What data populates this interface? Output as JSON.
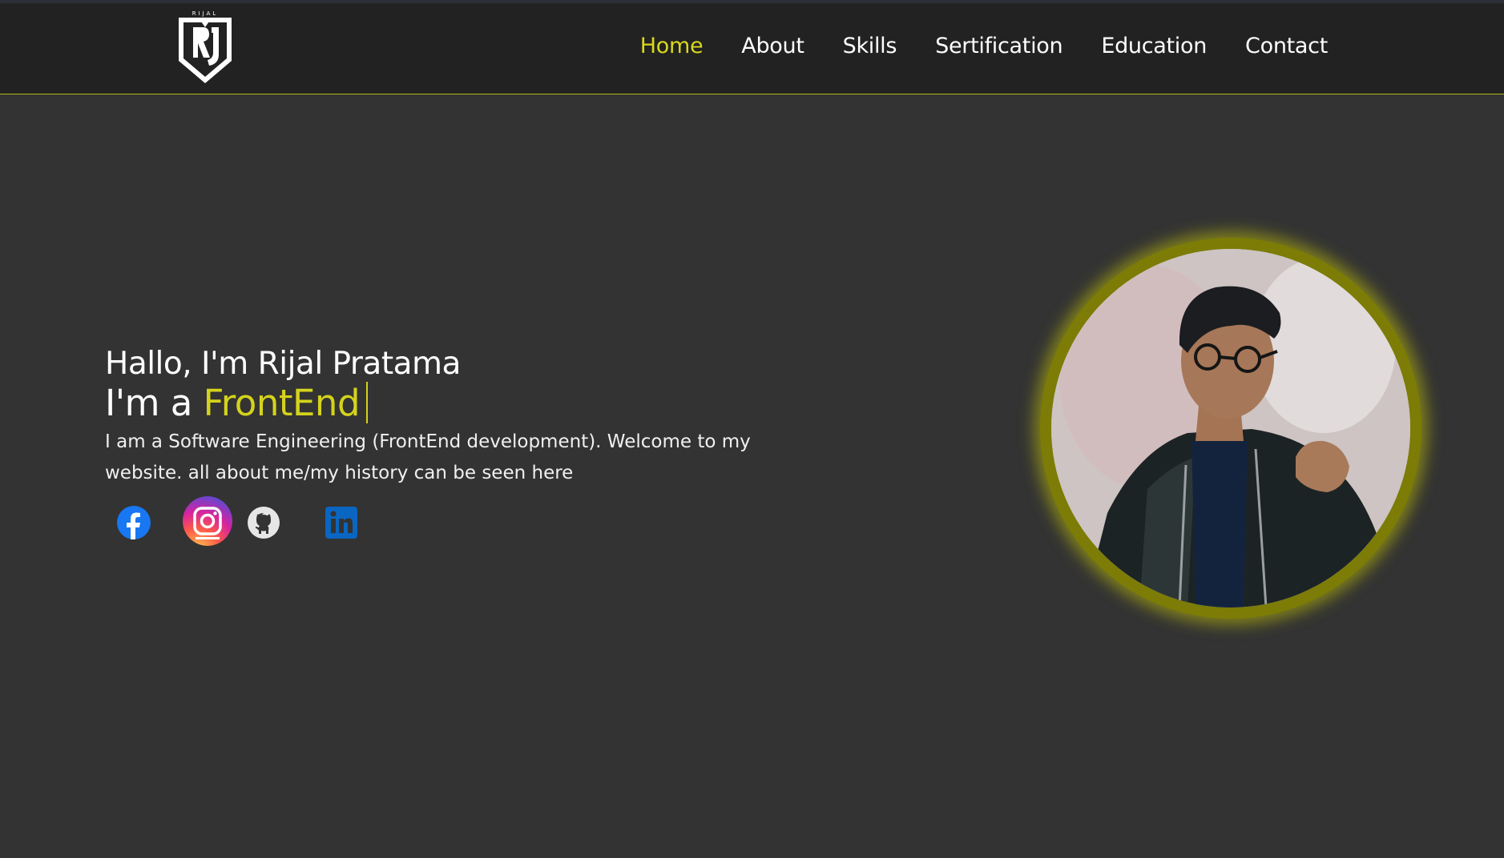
{
  "nav": {
    "logo_letters": "RIJAL",
    "items": [
      {
        "label": "Home",
        "active": true
      },
      {
        "label": "About",
        "active": false
      },
      {
        "label": "Skills",
        "active": false
      },
      {
        "label": "Sertification",
        "active": false
      },
      {
        "label": "Education",
        "active": false
      },
      {
        "label": "Contact",
        "active": false
      }
    ]
  },
  "hero": {
    "greeting": "Hallo, I'm Rijal Pratama",
    "role_prefix": "I'm a",
    "role_highlight": "FrontEnd",
    "description": "I am a Software Engineering (FrontEnd development). Welcome to my website. all about me/my history can be seen here"
  },
  "socials": [
    {
      "icon": "facebook-icon"
    },
    {
      "icon": "instagram-icon"
    },
    {
      "icon": "github-icon"
    },
    {
      "icon": "linkedin-icon"
    }
  ],
  "colors": {
    "background": "#333333",
    "navbar": "#222222",
    "accent": "#d4d31c",
    "avatar_ring": "#7c7c06"
  }
}
